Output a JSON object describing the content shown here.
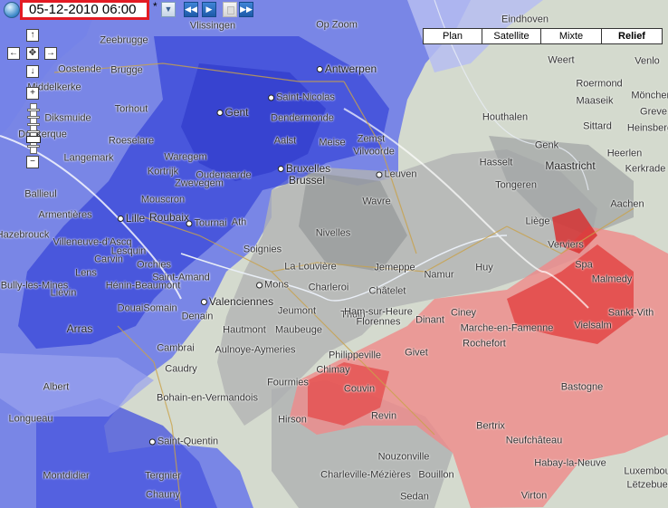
{
  "timestamp": "05-12-2010 06:00",
  "timestamp_marker": "*",
  "map_types": [
    {
      "label": "Plan",
      "active": false
    },
    {
      "label": "Satellite",
      "active": false
    },
    {
      "label": "Mixte",
      "active": false
    },
    {
      "label": "Relief",
      "active": true
    }
  ],
  "colors": {
    "highlight_border": "#e31b23",
    "snow_blue": "#4a5ee0",
    "rain_red": "#e84a4a",
    "precip_gray": "#a9a9a9"
  },
  "controls": {
    "pan_up": "↑",
    "pan_left": "←",
    "pan_right": "→",
    "pan_down": "↓",
    "pan_center": "✥",
    "zoom_in": "+",
    "zoom_out": "−",
    "dropdown": "▼",
    "prev": "◀◀",
    "play": "▶",
    "next": "▶▶"
  },
  "cities": [
    {
      "name": "Zeebrugge",
      "big": false,
      "dot": false
    },
    {
      "name": "Oostende",
      "big": false,
      "dot": false
    },
    {
      "name": "Brugge",
      "big": false,
      "dot": false
    },
    {
      "name": "Middelkerke",
      "big": false,
      "dot": false
    },
    {
      "name": "Diksmuide",
      "big": false,
      "dot": false
    },
    {
      "name": "Roeselare",
      "big": false,
      "dot": false
    },
    {
      "name": "Torhout",
      "big": false,
      "dot": false
    },
    {
      "name": "Langemark",
      "big": false,
      "dot": false
    },
    {
      "name": "Dunkerque",
      "big": false,
      "dot": false
    },
    {
      "name": "Vlissingen",
      "big": false,
      "dot": false
    },
    {
      "name": "Antwerpen",
      "big": true,
      "dot": true
    },
    {
      "name": "Saint-Nicolas",
      "big": false,
      "dot": true
    },
    {
      "name": "Gent",
      "big": true,
      "dot": true
    },
    {
      "name": "Dendermonde",
      "big": false,
      "dot": false
    },
    {
      "name": "Aalst",
      "big": false,
      "dot": false
    },
    {
      "name": "Meise",
      "big": false,
      "dot": false
    },
    {
      "name": "Zemst",
      "big": false,
      "dot": false
    },
    {
      "name": "Vilvoorde",
      "big": false,
      "dot": false
    },
    {
      "name": "Bruxelles",
      "big": true,
      "dot": true
    },
    {
      "name": "Brussel",
      "big": true,
      "dot": false
    },
    {
      "name": "Leuven",
      "big": false,
      "dot": true
    },
    {
      "name": "Oudenaarde",
      "big": false,
      "dot": false
    },
    {
      "name": "Waregem",
      "big": false,
      "dot": false
    },
    {
      "name": "Kortrijk",
      "big": false,
      "dot": false
    },
    {
      "name": "Zwevegem",
      "big": false,
      "dot": false
    },
    {
      "name": "Mouscron",
      "big": false,
      "dot": false
    },
    {
      "name": "Lille",
      "big": true,
      "dot": true
    },
    {
      "name": "Roubaix",
      "big": true,
      "dot": false
    },
    {
      "name": "Tournai",
      "big": false,
      "dot": true
    },
    {
      "name": "Villeneuve-d'Ascq",
      "big": false,
      "dot": false
    },
    {
      "name": "Armentières",
      "big": false,
      "dot": false
    },
    {
      "name": "Wavre",
      "big": false,
      "dot": false
    },
    {
      "name": "Nivelles",
      "big": false,
      "dot": false
    },
    {
      "name": "Soignies",
      "big": false,
      "dot": false
    },
    {
      "name": "La Louvière",
      "big": false,
      "dot": false
    },
    {
      "name": "Mons",
      "big": false,
      "dot": true
    },
    {
      "name": "Charleroi",
      "big": false,
      "dot": false
    },
    {
      "name": "Namur",
      "big": false,
      "dot": false
    },
    {
      "name": "Huy",
      "big": false,
      "dot": false
    },
    {
      "name": "Liège",
      "big": false,
      "dot": false
    },
    {
      "name": "Verviers",
      "big": false,
      "dot": false
    },
    {
      "name": "Spa",
      "big": false,
      "dot": false
    },
    {
      "name": "Malmedy",
      "big": false,
      "dot": false
    },
    {
      "name": "Sankt-Vith",
      "big": false,
      "dot": false
    },
    {
      "name": "Vielsalm",
      "big": false,
      "dot": false
    },
    {
      "name": "Hasselt",
      "big": false,
      "dot": false
    },
    {
      "name": "Tongeren",
      "big": false,
      "dot": false
    },
    {
      "name": "Maastricht",
      "big": true,
      "dot": false
    },
    {
      "name": "Heerlen",
      "big": false,
      "dot": false
    },
    {
      "name": "Kerkrade",
      "big": false,
      "dot": false
    },
    {
      "name": "Aachen",
      "big": false,
      "dot": false
    },
    {
      "name": "Genk",
      "big": false,
      "dot": false
    },
    {
      "name": "Houthalen",
      "big": false,
      "dot": false
    },
    {
      "name": "Sittard",
      "big": false,
      "dot": false
    },
    {
      "name": "Maaseik",
      "big": false,
      "dot": false
    },
    {
      "name": "Roermond",
      "big": false,
      "dot": false
    },
    {
      "name": "Weert",
      "big": false,
      "dot": false
    },
    {
      "name": "Venlo",
      "big": false,
      "dot": false
    },
    {
      "name": "Mönchen",
      "big": false,
      "dot": false
    },
    {
      "name": "Greve",
      "big": false,
      "dot": false
    },
    {
      "name": "Heinsberg",
      "big": false,
      "dot": false
    },
    {
      "name": "Eindhoven",
      "big": false,
      "dot": false
    },
    {
      "name": "Lens",
      "big": false,
      "dot": false
    },
    {
      "name": "Liévin",
      "big": false,
      "dot": false
    },
    {
      "name": "Bully-les-Mines",
      "big": false,
      "dot": false
    },
    {
      "name": "Carvin",
      "big": false,
      "dot": false
    },
    {
      "name": "Orchies",
      "big": false,
      "dot": false
    },
    {
      "name": "Lesquin",
      "big": false,
      "dot": false
    },
    {
      "name": "Saint-Amand",
      "big": false,
      "dot": false
    },
    {
      "name": "Hénin-Beaumont",
      "big": false,
      "dot": false
    },
    {
      "name": "Douai",
      "big": false,
      "dot": false
    },
    {
      "name": "Somain",
      "big": false,
      "dot": false
    },
    {
      "name": "Denain",
      "big": false,
      "dot": false
    },
    {
      "name": "Valenciennes",
      "big": true,
      "dot": true
    },
    {
      "name": "Arras",
      "big": true,
      "dot": false
    },
    {
      "name": "Cambrai",
      "big": false,
      "dot": false
    },
    {
      "name": "Caudry",
      "big": false,
      "dot": false
    },
    {
      "name": "Hautmont",
      "big": false,
      "dot": false
    },
    {
      "name": "Maubeuge",
      "big": false,
      "dot": false
    },
    {
      "name": "Jeumont",
      "big": false,
      "dot": false
    },
    {
      "name": "Aulnoye-Aymeries",
      "big": false,
      "dot": false
    },
    {
      "name": "Thuin",
      "big": false,
      "dot": false
    },
    {
      "name": "Ham-sur-Heure",
      "big": false,
      "dot": false
    },
    {
      "name": "Florennes",
      "big": false,
      "dot": false
    },
    {
      "name": "Philippeville",
      "big": false,
      "dot": false
    },
    {
      "name": "Dinant",
      "big": false,
      "dot": false
    },
    {
      "name": "Ciney",
      "big": false,
      "dot": false
    },
    {
      "name": "Marche-en-Famenne",
      "big": false,
      "dot": false
    },
    {
      "name": "Rochefort",
      "big": false,
      "dot": false
    },
    {
      "name": "Givet",
      "big": false,
      "dot": false
    },
    {
      "name": "Couvin",
      "big": false,
      "dot": false
    },
    {
      "name": "Chimay",
      "big": false,
      "dot": false
    },
    {
      "name": "Fourmies",
      "big": false,
      "dot": false
    },
    {
      "name": "Hirson",
      "big": false,
      "dot": false
    },
    {
      "name": "Revin",
      "big": false,
      "dot": false
    },
    {
      "name": "Bohain-en-Vermandois",
      "big": false,
      "dot": false
    },
    {
      "name": "Albert",
      "big": false,
      "dot": false
    },
    {
      "name": "Longueau",
      "big": false,
      "dot": false
    },
    {
      "name": "Montdidier",
      "big": false,
      "dot": false
    },
    {
      "name": "Saint-Quentin",
      "big": false,
      "dot": true
    },
    {
      "name": "Tergnier",
      "big": false,
      "dot": false
    },
    {
      "name": "Chauny",
      "big": false,
      "dot": false
    },
    {
      "name": "Charleville-Mézières",
      "big": false,
      "dot": false
    },
    {
      "name": "Nouzonville",
      "big": false,
      "dot": false
    },
    {
      "name": "Bouillon",
      "big": false,
      "dot": false
    },
    {
      "name": "Bertrix",
      "big": false,
      "dot": false
    },
    {
      "name": "Neufchâteau",
      "big": false,
      "dot": false
    },
    {
      "name": "Bastogne",
      "big": false,
      "dot": false
    },
    {
      "name": "Habay-la-Neuve",
      "big": false,
      "dot": false
    },
    {
      "name": "Virton",
      "big": false,
      "dot": false
    },
    {
      "name": "Sedan",
      "big": false,
      "dot": false
    },
    {
      "name": "Jemeppe",
      "big": false,
      "dot": false
    },
    {
      "name": "Châtelet",
      "big": false,
      "dot": false
    },
    {
      "name": "Ath",
      "big": false,
      "dot": false
    },
    {
      "name": "Luxembourg",
      "big": false,
      "dot": false
    },
    {
      "name": "Lëtzebuerg",
      "big": false,
      "dot": false
    },
    {
      "name": "Op Zoom",
      "big": false,
      "dot": false
    },
    {
      "name": "Ballieul",
      "big": false,
      "dot": false
    },
    {
      "name": "Hazebrouck",
      "big": false,
      "dot": false
    }
  ]
}
